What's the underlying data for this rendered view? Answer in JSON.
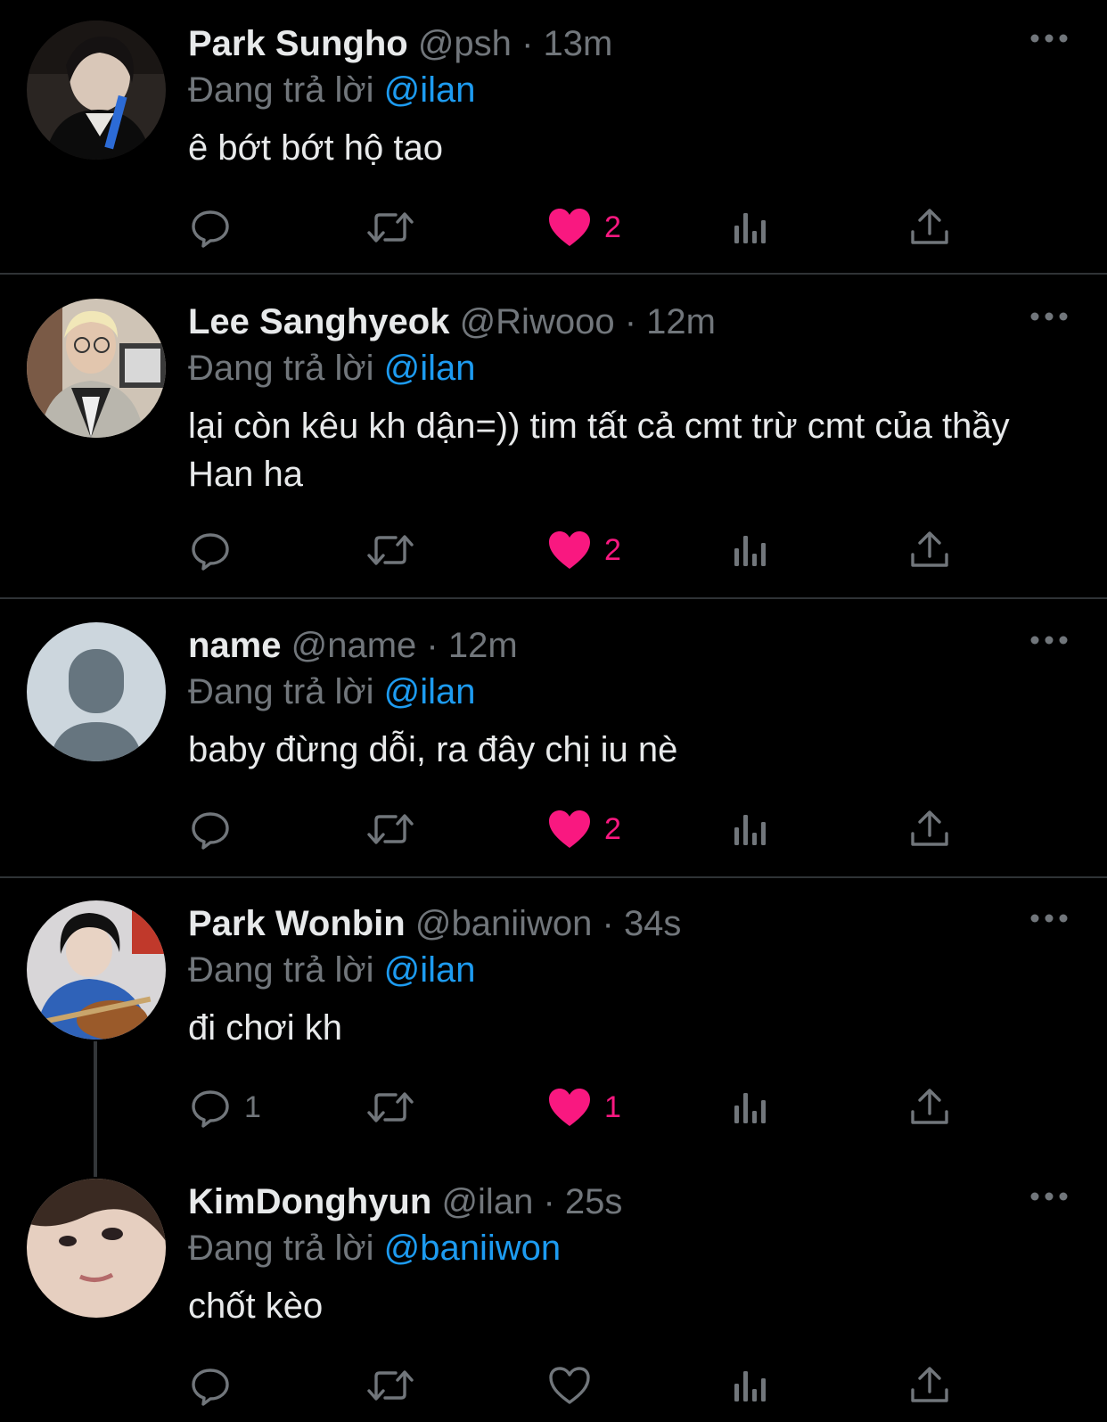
{
  "replying_prefix": "Đang trả lời",
  "tweets": [
    {
      "name": "Park Sungho",
      "handle": "@psh",
      "dot": "·",
      "time": "13m",
      "reply_to": "@ilan",
      "text": "ê bớt bớt hộ tao",
      "replies": "",
      "likes": "2",
      "liked": true
    },
    {
      "name": "Lee Sanghyeok",
      "handle": "@Riwooo",
      "dot": "·",
      "time": "12m",
      "reply_to": "@ilan",
      "text": "lại còn kêu kh dận=)) tim tất cả cmt trừ cmt của thầy Han ha",
      "replies": "",
      "likes": "2",
      "liked": true
    },
    {
      "name": "name",
      "handle": "@name",
      "dot": "·",
      "time": "12m",
      "reply_to": "@ilan",
      "text": "baby đừng dỗi, ra đây chị iu nè",
      "replies": "",
      "likes": "2",
      "liked": true
    },
    {
      "name": "Park Wonbin",
      "handle": "@baniiwon",
      "dot": "·",
      "time": "34s",
      "reply_to": "@ilan",
      "text": "đi chơi kh",
      "replies": "1",
      "likes": "1",
      "liked": true
    },
    {
      "name": "KimDonghyun",
      "handle": "@ilan",
      "dot": "·",
      "time": "25s",
      "reply_to": "@baniiwon",
      "text": "chốt kèo",
      "replies": "",
      "likes": "",
      "liked": false
    }
  ],
  "colors": {
    "accent": "#1d9bf0",
    "like": "#f91880",
    "muted": "#71767b",
    "text": "#e7e9ea",
    "background": "#000000"
  },
  "icons": [
    "reply-icon",
    "retweet-icon",
    "heart-icon",
    "views-icon",
    "share-icon",
    "more-icon"
  ]
}
